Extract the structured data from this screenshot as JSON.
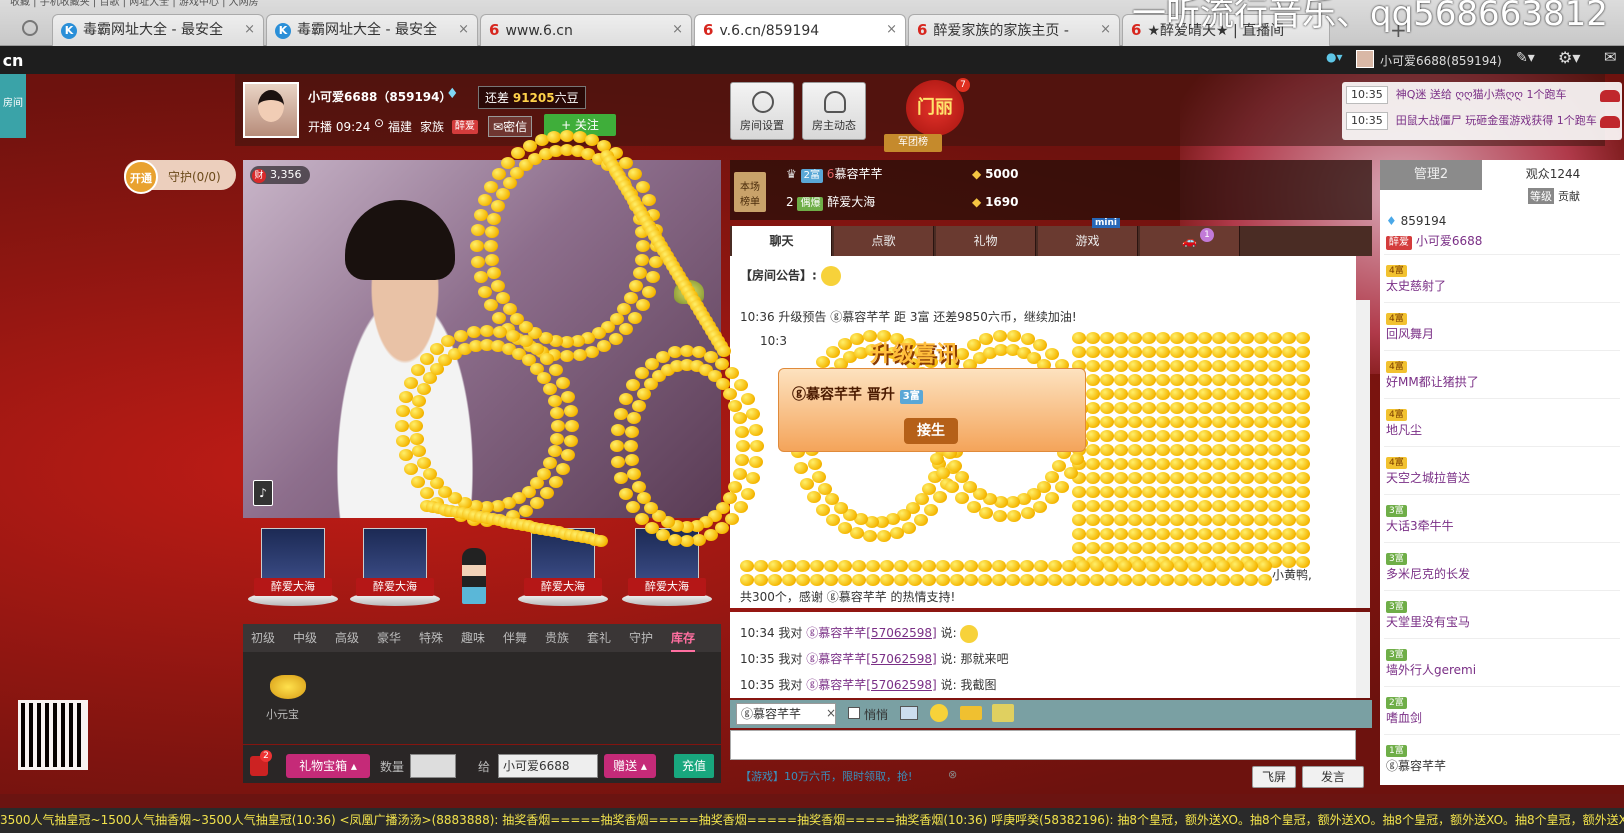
{
  "browser": {
    "tabs": [
      {
        "icon": "k",
        "label": "毒霸网址大全 - 最安全"
      },
      {
        "icon": "k",
        "label": "毒霸网址大全 - 最安全"
      },
      {
        "icon": "6",
        "label": "www.6.cn"
      },
      {
        "icon": "6",
        "label": "v.6.cn/859194"
      },
      {
        "icon": "6",
        "label": "醉爱家族的家族主页 - "
      },
      {
        "icon": "6",
        "label": "★醉爱晴天★ | 直播间"
      }
    ],
    "new_tab": "+",
    "overlay_text": "一听流行音乐、qq568663812",
    "bookmarks": "收藏 | 手机收藏夹 | 百歌 | 网址大全 | 游戏中心 | 大网房"
  },
  "site": {
    "logo": "cn",
    "side_room": "房间",
    "user": "小可爱6688(859194)"
  },
  "host": {
    "name": "小可爱6688（859194）",
    "coins_prefix": "还差",
    "coins_value": "91205",
    "coins_suffix": "六豆",
    "start_time": "开播 09:24",
    "location": "福建",
    "family_label": "家族",
    "family_tag": "醉爱",
    "secret_label": "密信",
    "follow_label": "+ 关注",
    "room_settings": "房间设置",
    "host_news": "房主动态",
    "gate_label": "门丽",
    "gate_badge": "7",
    "army_label": "军团榜"
  },
  "notify": [
    {
      "time": "10:35",
      "text": "神Q迷 送给 ღღ猫小燕ღღ 1个跑车"
    },
    {
      "time": "10:35",
      "text": "田鼠大战僵尸 玩砸金蛋游戏获得 1个跑车"
    }
  ],
  "guard": {
    "button": "开通",
    "label": "守护(0/0)"
  },
  "video": {
    "wealth": "3,356",
    "wealth_icon": "财"
  },
  "seats": [
    "醉爱大海",
    "醉爱大海",
    "醉爱大海",
    "醉爱大海"
  ],
  "gift": {
    "categories": [
      "初级",
      "中级",
      "高级",
      "豪华",
      "特殊",
      "趣味",
      "伴舞",
      "贵族",
      "套礼",
      "守护",
      "库存"
    ],
    "item_label": "小元宝",
    "box_button": "礼物宝箱 ▴",
    "qty_label": "数量",
    "to_label": "给",
    "to_value": "小可爱6688",
    "send_button": "赠送 ▴",
    "charge_button": "充值",
    "cart_badge": "2"
  },
  "rank": {
    "badge": "本场 榜单",
    "rows": [
      {
        "pos": "1",
        "level": "2富",
        "name": "慕容芊芊",
        "score": "5000"
      },
      {
        "pos": "2",
        "level": "偶爆",
        "name": "醉爱大海",
        "score": "1690"
      }
    ]
  },
  "chat_tabs": [
    "聊天",
    "点歌",
    "礼物",
    "游戏"
  ],
  "car_badge": "1",
  "mini_badge": "mini",
  "chat": {
    "notice": "【房间公告】:",
    "upgrade_hint": "10:36 升级预告 ⓖ慕容芊芊 距 3富 还差9850六币，继续加油!",
    "partial_line": "10:3",
    "duck_line": "小黄鸭,",
    "thanks_line": "共300个，感谢 ⓖ慕容芊芊 的热情支持!",
    "lines": [
      {
        "time": "10:34",
        "pre": "我对",
        "name": "ⓖ慕容芊芊",
        "id": "[57062598]",
        "post": "说:",
        "msg": ""
      },
      {
        "time": "10:35",
        "pre": "我对",
        "name": "ⓖ慕容芊芊",
        "id": "[57062598]",
        "post": "说:",
        "msg": "那就来吧"
      },
      {
        "time": "10:35",
        "pre": "我对",
        "name": "ⓖ慕容芊芊",
        "id": "[57062598]",
        "post": "说:",
        "msg": "我截图"
      }
    ],
    "reply_to": "ⓖ慕容芊芊",
    "whisper": "悄悄",
    "game_tip": "【游戏】10万六币，限时领取，抢!",
    "fly_button": "飞屏",
    "send_button": "发言"
  },
  "upgrade_popup": {
    "title": "升级喜讯",
    "text": "ⓖ慕容芊芊  晋升",
    "level": "3富",
    "button": "接生"
  },
  "sidebar": {
    "admin_tab": "管理2",
    "viewers_tab": "观众1244",
    "sub_level": "等级",
    "sub_contrib": "贡献",
    "host_id": "859194",
    "host_tag": "醉爱",
    "host_name": "小可爱6688",
    "users": [
      {
        "level": "4富",
        "name": "太史慈射了"
      },
      {
        "level": "4富",
        "name": "回风舞月"
      },
      {
        "level": "4富",
        "name": "好MM都让猪拱了"
      },
      {
        "level": "4富",
        "name": "地凡尘"
      },
      {
        "level": "4富",
        "name": "天空之城拉普达"
      },
      {
        "level": "3富",
        "name": "大话3牵牛牛"
      },
      {
        "level": "3富",
        "name": "多米尼克的长发"
      },
      {
        "level": "3富",
        "name": "天堂里没有宝马"
      },
      {
        "level": "3富",
        "name": "墙外行人geremi"
      },
      {
        "level": "2富",
        "name": "嗜血剑"
      },
      {
        "level": "1富",
        "name": "ⓖ慕容芊芊"
      }
    ]
  },
  "ticker": "3500人气抽皇冠~1500人气抽香烟~3500人气抽皇冠(10:36)    <凤凰广播汤汤>(8883888): 抽奖香烟=====抽奖香烟=====抽奖香烟=====抽奖香烟=====抽奖香烟(10:36)    呼庚呼癸(58382196): 抽8个皇冠，额外送XO。抽8个皇冠，额外送XO。抽8个皇冠，额外送XO。抽8个皇冠，额外送XO。"
}
